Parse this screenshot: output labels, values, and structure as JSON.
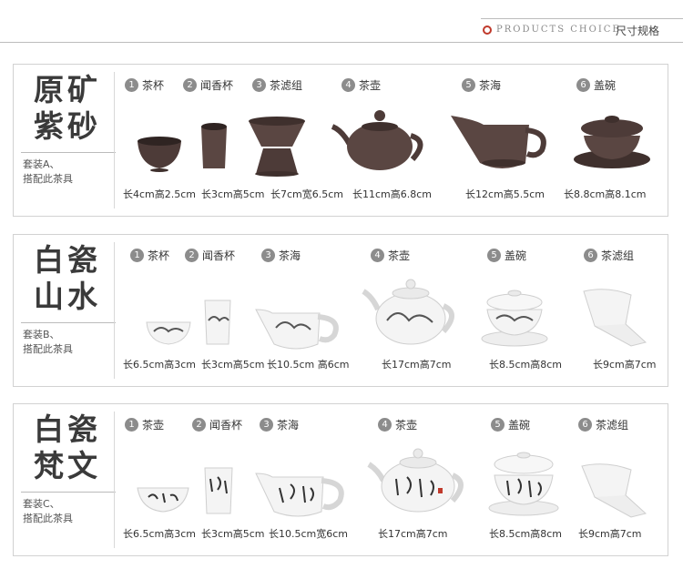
{
  "header": {
    "en": "PRODUCTS CHOICE",
    "cn": "尺寸规格"
  },
  "sets": [
    {
      "title_line1": "原矿",
      "title_line2": "紫砂",
      "sub_line1": "套装A、",
      "sub_line2": "搭配此茶具",
      "items": [
        {
          "num": "1",
          "name": "茶杯"
        },
        {
          "num": "2",
          "name": "闻香杯"
        },
        {
          "num": "3",
          "name": "茶滤组"
        },
        {
          "num": "4",
          "name": "茶壶"
        },
        {
          "num": "5",
          "name": "茶海"
        },
        {
          "num": "6",
          "name": "盖碗"
        }
      ],
      "dims": [
        "长4cm高2.5cm",
        "长3cm高5cm",
        "长7cm宽6.5cm",
        "长11cm高6.8cm",
        "长12cm高5.5cm",
        "长8.8cm高8.1cm"
      ],
      "colors": {
        "clay": "#5a4642",
        "clay_dark": "#3f302d"
      }
    },
    {
      "title_line1": "白瓷",
      "title_line2": "山水",
      "sub_line1": "套装B、",
      "sub_line2": "搭配此茶具",
      "items": [
        {
          "num": "1",
          "name": "茶杯"
        },
        {
          "num": "2",
          "name": "闻香杯"
        },
        {
          "num": "3",
          "name": "茶海"
        },
        {
          "num": "4",
          "name": "茶壶"
        },
        {
          "num": "5",
          "name": "盖碗"
        },
        {
          "num": "6",
          "name": "茶滤组"
        }
      ],
      "dims": [
        "长6.5cm高3cm",
        "长3cm高5cm",
        "长10.5cm 高6cm",
        "长17cm高7cm",
        "长8.5cm高8cm",
        "长9cm高7cm"
      ]
    },
    {
      "title_line1": "白瓷",
      "title_line2": "梵文",
      "sub_line1": "套装C、",
      "sub_line2": "搭配此茶具",
      "items": [
        {
          "num": "1",
          "name": "茶壶"
        },
        {
          "num": "2",
          "name": "闻香杯"
        },
        {
          "num": "3",
          "name": "茶海"
        },
        {
          "num": "4",
          "name": "茶壶"
        },
        {
          "num": "5",
          "name": "盖碗"
        },
        {
          "num": "6",
          "name": "茶滤组"
        }
      ],
      "dims": [
        "长6.5cm高3cm",
        "长3cm高5cm",
        "长10.5cm宽6cm",
        "长17cm高7cm",
        "长8.5cm高8cm",
        "长9cm高7cm"
      ]
    }
  ]
}
